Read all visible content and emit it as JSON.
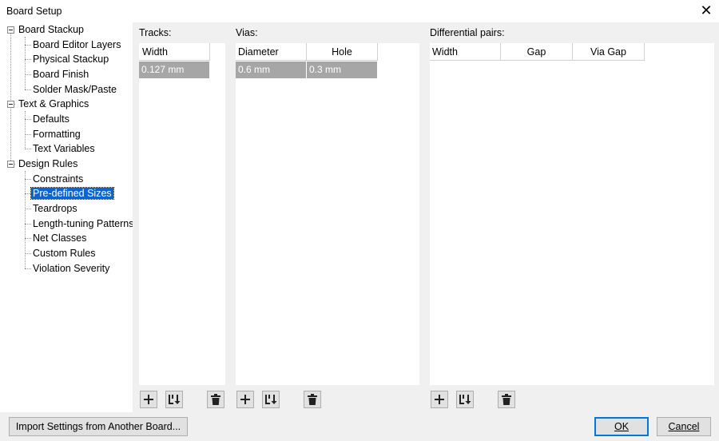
{
  "window": {
    "title": "Board Setup",
    "close_glyph": "✕"
  },
  "tree": {
    "groups": [
      {
        "label": "Board Stackup",
        "children": [
          "Board Editor Layers",
          "Physical Stackup",
          "Board Finish",
          "Solder Mask/Paste"
        ]
      },
      {
        "label": "Text & Graphics",
        "children": [
          "Defaults",
          "Formatting",
          "Text Variables"
        ]
      },
      {
        "label": "Design Rules",
        "children": [
          "Constraints",
          "Pre-defined Sizes",
          "Teardrops",
          "Length-tuning Patterns",
          "Net Classes",
          "Custom Rules",
          "Violation Severity"
        ]
      }
    ],
    "selected": "Pre-defined Sizes"
  },
  "tracks": {
    "label": "Tracks:",
    "columns": [
      "Width"
    ],
    "rows": [
      [
        "0.127 mm"
      ]
    ]
  },
  "vias": {
    "label": "Vias:",
    "columns": [
      "Diameter",
      "Hole"
    ],
    "rows": [
      [
        "0.6 mm",
        "0.3 mm"
      ]
    ]
  },
  "diff_pairs": {
    "label": "Differential pairs:",
    "columns": [
      "Width",
      "Gap",
      "Via Gap"
    ],
    "rows": []
  },
  "toolbar_icons": [
    "add-icon",
    "sort-icon",
    "trash-icon"
  ],
  "buttons": {
    "import": "Import Settings from Another Board...",
    "ok": "OK",
    "cancel": "Cancel"
  },
  "colors": {
    "selection": "#0a64d2",
    "row_fill": "#a6a6a6",
    "panel_bg": "#f0f0f0",
    "default_button_border": "#0078d7"
  }
}
